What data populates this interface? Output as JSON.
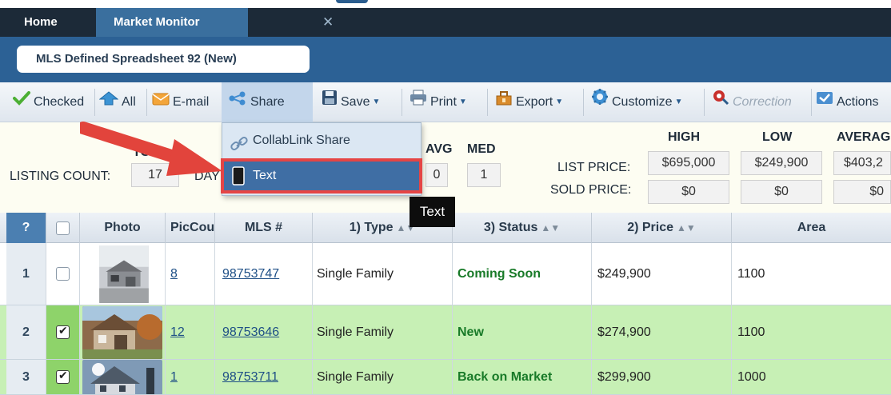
{
  "tabs": [
    {
      "label": "Home"
    },
    {
      "label": "Market Monitor",
      "close": "✕"
    }
  ],
  "spreadsheet_title": "MLS Defined Spreadsheet 92 (New)",
  "toolbar": {
    "checked": "Checked",
    "all": "All",
    "email": "E-mail",
    "share": "Share",
    "save": "Save",
    "print": "Print",
    "export": "Export",
    "customize": "Customize",
    "correction": "Correction",
    "actions": "Actions"
  },
  "share_menu": {
    "collablink": "CollabLink Share",
    "text": "Text"
  },
  "tooltip": "Text",
  "stats": {
    "tot_partial": "TO",
    "listing_count_label": "LISTING COUNT:",
    "listing_count": "17",
    "days_partial": "DAY",
    "avg_label": "AVG",
    "med_label": "MED",
    "avg_value": "0",
    "med_value": "1",
    "high_label": "HIGH",
    "low_label": "LOW",
    "average_label": "AVERAG",
    "list_price_label": "LIST PRICE:",
    "sold_price_label": "SOLD PRICE:",
    "list_high": "$695,000",
    "list_low": "$249,900",
    "list_avg": "$403,2",
    "sold_high": "$0",
    "sold_low": "$0",
    "sold_avg": "$0"
  },
  "table": {
    "headers": {
      "help": "?",
      "photo": "Photo",
      "piccount": "PicCou",
      "mls": "MLS #",
      "type": "1) Type",
      "status": "3) Status",
      "price": "2) Price",
      "area": "Area"
    },
    "rows": [
      {
        "num": "1",
        "checked": false,
        "piccount": "8",
        "mls": "98753747",
        "type": "Single Family",
        "status": "Coming Soon",
        "price": "$249,900",
        "area": "1100"
      },
      {
        "num": "2",
        "checked": true,
        "piccount": "12",
        "mls": "98753646",
        "type": "Single Family",
        "status": "New",
        "price": "$274,900",
        "area": "1100"
      },
      {
        "num": "3",
        "checked": true,
        "piccount": "1",
        "mls": "98753711",
        "type": "Single Family",
        "status": "Back on Market",
        "price": "$299,900",
        "area": "1000"
      }
    ]
  },
  "colors": {
    "tabbar": "#1c2a38",
    "active_tab": "#3a6f9e",
    "header_band": "#2c6195",
    "checked_row": "#c7f0b5",
    "status_green": "#187a28",
    "highlight_red": "#e54545"
  },
  "icons": {
    "checked": "check-icon",
    "all": "all-arrow-icon",
    "email": "envelope-icon",
    "share": "share-icon",
    "save": "floppy-icon",
    "print": "printer-icon",
    "export": "export-icon",
    "customize": "gear-icon",
    "correction": "correction-icon",
    "actions": "actions-icon",
    "collablink": "link-icon",
    "text": "phone-icon"
  }
}
